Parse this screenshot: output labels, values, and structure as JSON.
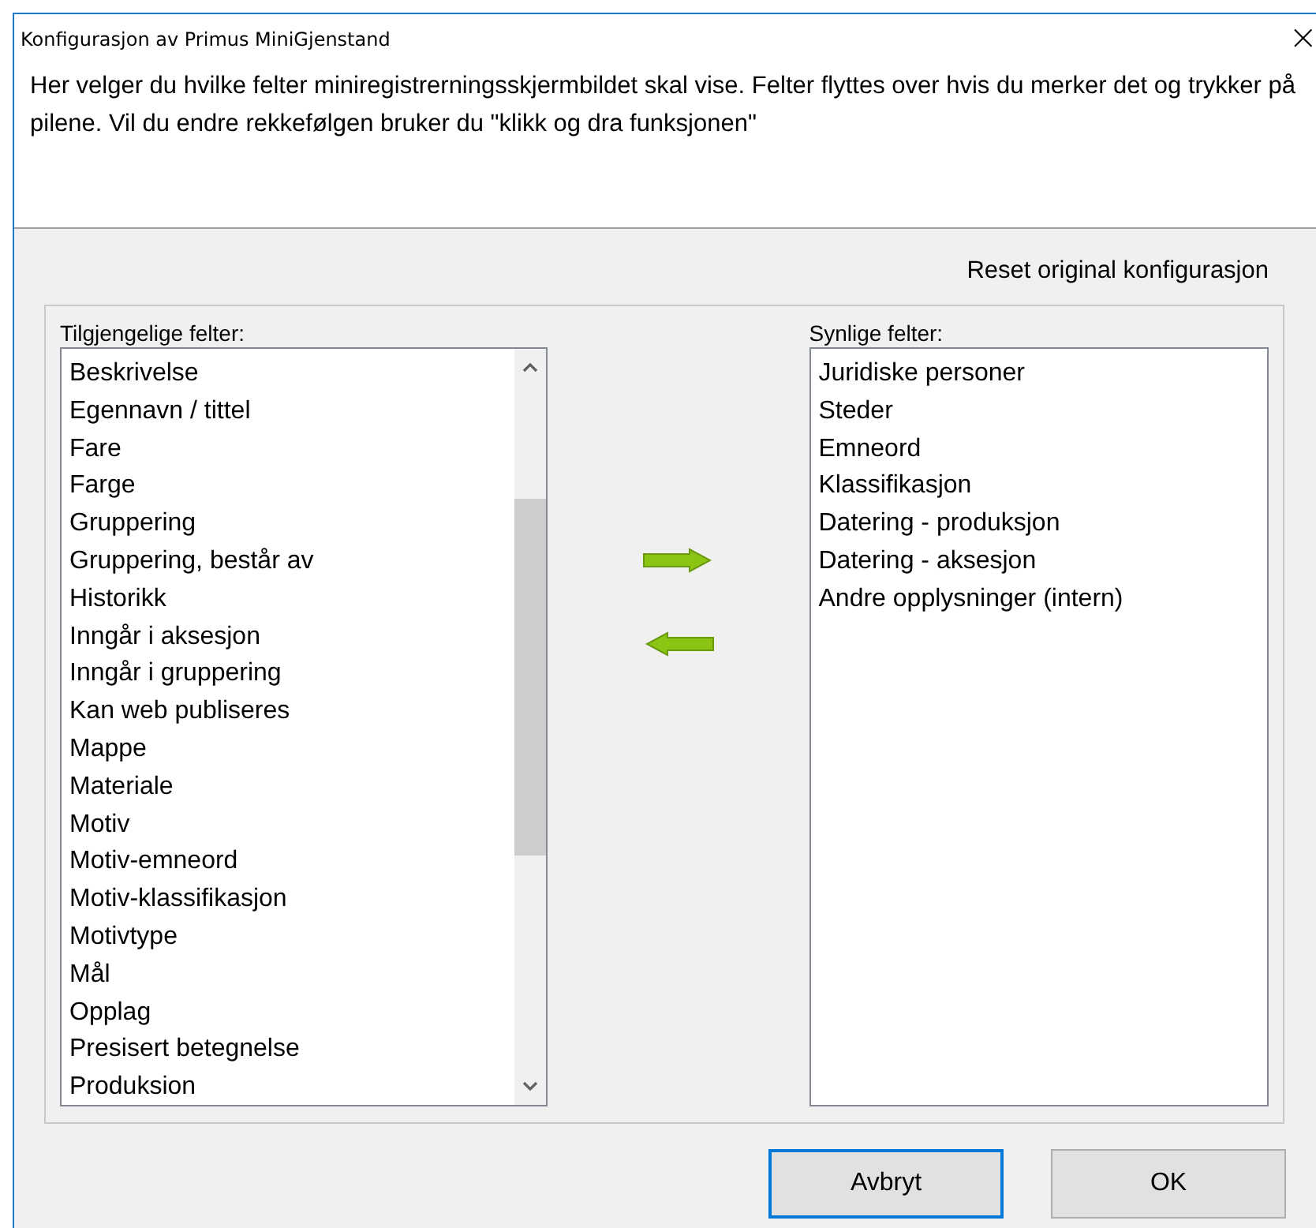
{
  "window": {
    "title": "Konfigurasjon av Primus MiniGjenstand",
    "close": "×"
  },
  "description": "Her velger du hvilke felter miniregistrerningsskjermbildet skal vise. Felter flyttes over hvis du merker det og trykker på pilene. Vil du endre rekkefølgen bruker du \"klikk og dra funksjonen\"",
  "reset_link": "Reset original konfigurasjon",
  "available": {
    "label": "Tilgjengelige felter:",
    "items": [
      "Beskrivelse",
      "Egennavn / tittel",
      "Fare",
      "Farge",
      "Gruppering",
      "Gruppering,  består av",
      "Historikk",
      "Inngår i aksesjon",
      "Inngår i gruppering",
      "Kan web publiseres",
      "Mappe",
      "Materiale",
      "Motiv",
      "Motiv-emneord",
      "Motiv-klassifikasjon",
      "Motivtype",
      "Mål",
      "Opplag",
      "Presisert betegnelse",
      "Produksion"
    ]
  },
  "visible": {
    "label": "Synlige felter:",
    "items": [
      "Juridiske personer",
      "Steder",
      "Emneord",
      "Klassifikasjon",
      "Datering - produksjon",
      "Datering - aksesjon",
      "Andre opplysninger (intern)"
    ]
  },
  "buttons": [
    {
      "label": "Avbryt",
      "focused": true
    },
    {
      "label": "OK",
      "focused": false
    }
  ]
}
